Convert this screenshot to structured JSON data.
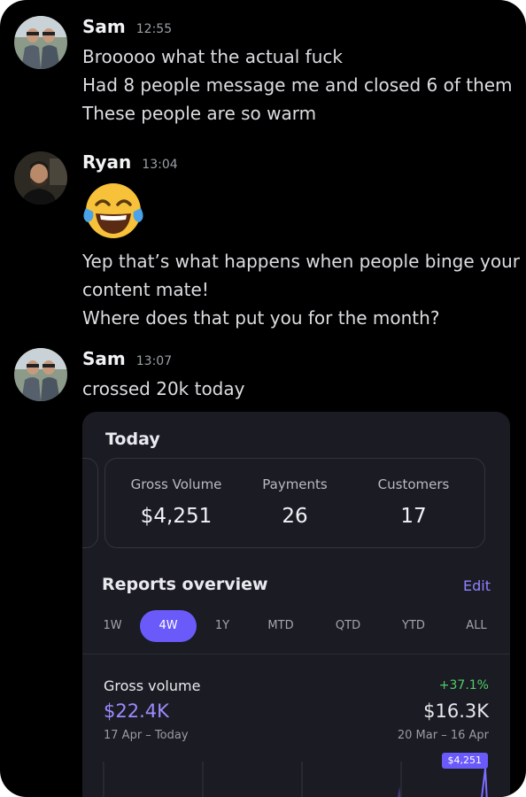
{
  "messages": [
    {
      "name": "Sam",
      "time": "12:55",
      "lines": [
        "Brooooo what the actual fuck",
        "Had 8 people message me and closed 6 of them",
        "These people are so warm"
      ]
    },
    {
      "name": "Ryan",
      "time": "13:04",
      "emoji": "tears-of-joy-emoji",
      "lines": [
        "Yep that’s what happens when people binge your",
        "content mate!",
        "Where does that put you for the month?"
      ]
    },
    {
      "name": "Sam",
      "time": "13:07",
      "lines": [
        "crossed 20k today"
      ]
    }
  ],
  "screenshot": {
    "today_label": "Today",
    "stats": [
      {
        "title": "Gross Volume",
        "value": "$4,251"
      },
      {
        "title": "Payments",
        "value": "26"
      },
      {
        "title": "Customers",
        "value": "17"
      }
    ],
    "reports_title": "Reports overview",
    "edit_label": "Edit",
    "tabs": [
      "1W",
      "4W",
      "1Y",
      "MTD",
      "QTD",
      "YTD",
      "ALL"
    ],
    "active_tab": "4W",
    "gross_volume": {
      "label": "Gross volume",
      "value": "$22.4K",
      "range": "17 Apr – Today",
      "compare_pct": "+37.1%",
      "compare_value": "$16.3K",
      "compare_range": "20 Mar – 16 Apr",
      "tooltip": "$4,251"
    }
  },
  "colors": {
    "accent": "#6a5af9",
    "positive": "#4fcf67",
    "background": "#000000"
  }
}
